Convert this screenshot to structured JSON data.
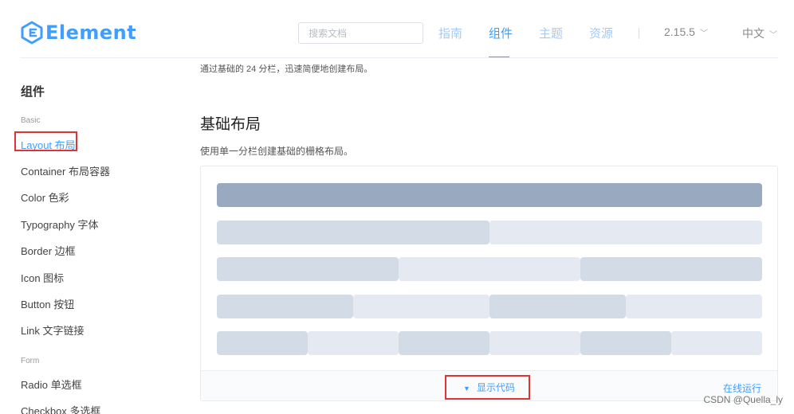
{
  "header": {
    "logo_text": "Element",
    "search_placeholder": "搜索文档",
    "nav": [
      "指南",
      "组件",
      "主题",
      "资源"
    ],
    "version": "2.15.5",
    "language": "中文",
    "brand_color": "#409eff"
  },
  "sidebar": {
    "title": "组件",
    "groups": [
      {
        "label": "Basic",
        "items": [
          "Layout 布局",
          "Container 布局容器",
          "Color 色彩",
          "Typography 字体",
          "Border 边框",
          "Icon 图标",
          "Button 按钮",
          "Link 文字链接"
        ]
      },
      {
        "label": "Form",
        "items": [
          "Radio 单选框",
          "Checkbox 多选框"
        ]
      }
    ],
    "active_item": "Layout 布局"
  },
  "main": {
    "intro": "通过基础的 24 分栏，迅速简便地创建布局。",
    "section_title": "基础布局",
    "section_desc": "使用单一分栏创建基础的栅格布局。",
    "show_code_label": "显示代码",
    "show_code_icon": "caret-down-icon",
    "run_online_label": "在线运行",
    "grid_rows": [
      {
        "span": 24,
        "columns": 1
      },
      {
        "span": 12,
        "columns": 2
      },
      {
        "span": 8,
        "columns": 3
      },
      {
        "span": 6,
        "columns": 4
      },
      {
        "span": 4,
        "columns": 6
      }
    ],
    "grid_colors": {
      "dark": "#99a9bf",
      "mid": "#d3dce6",
      "light": "#e5e9f2"
    }
  },
  "watermark": "CSDN @Quella_ly"
}
